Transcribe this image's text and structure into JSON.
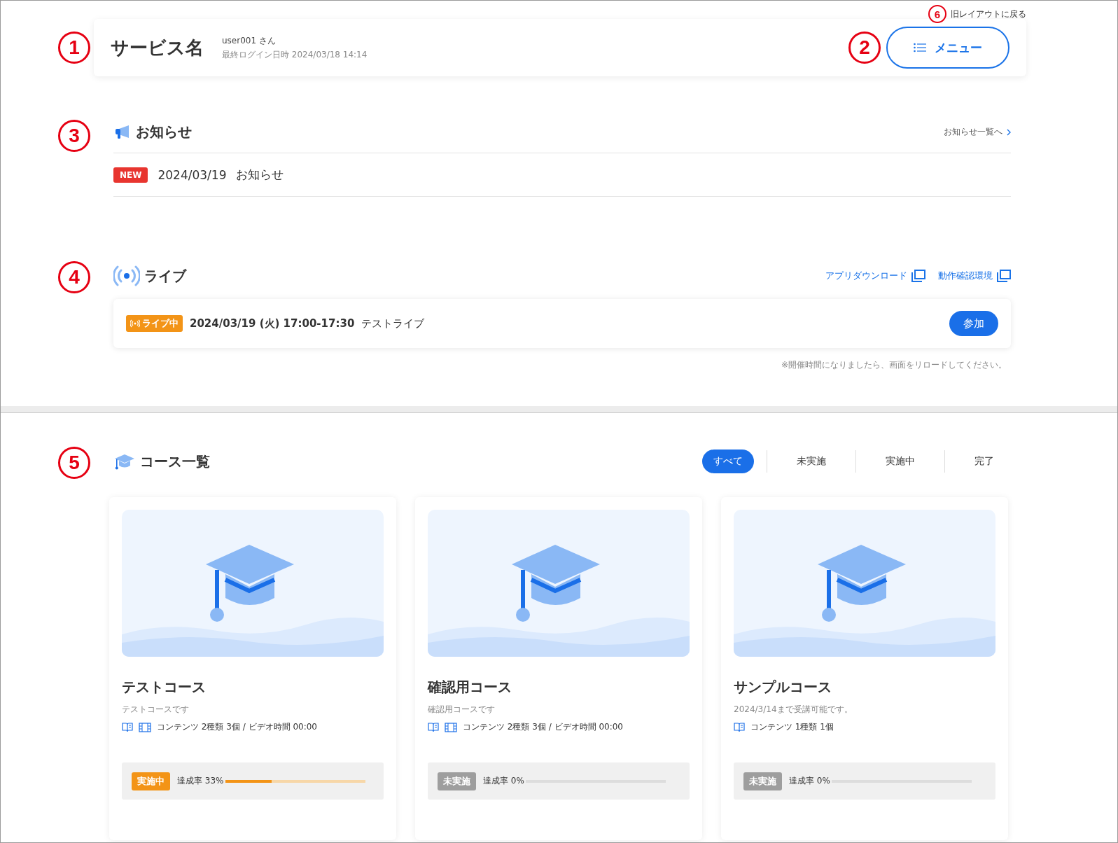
{
  "header": {
    "service_name": "サービス名",
    "user": "user001 さん",
    "last_login": "最終ログイン日時 2024/03/18 14:14",
    "menu_button": "メニュー",
    "old_layout_link": "旧レイアウトに戻る"
  },
  "markers": [
    "1",
    "2",
    "3",
    "4",
    "5",
    "6"
  ],
  "notices": {
    "title": "お知らせ",
    "list_link": "お知らせ一覧へ",
    "items": [
      {
        "badge": "NEW",
        "date": "2024/03/19",
        "text": "お知らせ"
      }
    ]
  },
  "live": {
    "title": "ライブ",
    "links": [
      "アプリダウンロード",
      "動作確認環境"
    ],
    "items": [
      {
        "badge": "ライブ中",
        "datetime": "2024/03/19 (火) 17:00-17:30",
        "name": "テストライブ",
        "button": "参加"
      }
    ],
    "note": "※開催時間になりましたら、画面をリロードしてください。"
  },
  "courses": {
    "title": "コース一覧",
    "filters": [
      {
        "label": "すべて",
        "selected": true
      },
      {
        "label": "未実施",
        "selected": false
      },
      {
        "label": "実施中",
        "selected": false
      },
      {
        "label": "完了",
        "selected": false
      }
    ],
    "items": [
      {
        "title": "テストコース",
        "description": "テストコースです",
        "has_video": true,
        "contents": "コンテンツ 2種類 3個 / ビデオ時間 00:00",
        "status": "実施中",
        "kind": "in_progress",
        "progress_label": "達成率 33%",
        "level": 0.33
      },
      {
        "title": "確認用コース",
        "description": "確認用コースです",
        "has_video": true,
        "contents": "コンテンツ 2種類 3個 / ビデオ時間 00:00",
        "status": "未実施",
        "kind": "not_started",
        "progress_label": "達成率 0%",
        "level": 0
      },
      {
        "title": "サンプルコース",
        "description": "2024/3/14まで受講可能です。",
        "has_video": false,
        "contents": "コンテンツ 1種類 1個",
        "status": "未実施",
        "kind": "not_started",
        "progress_label": "達成率 0%",
        "level": 0
      }
    ]
  }
}
